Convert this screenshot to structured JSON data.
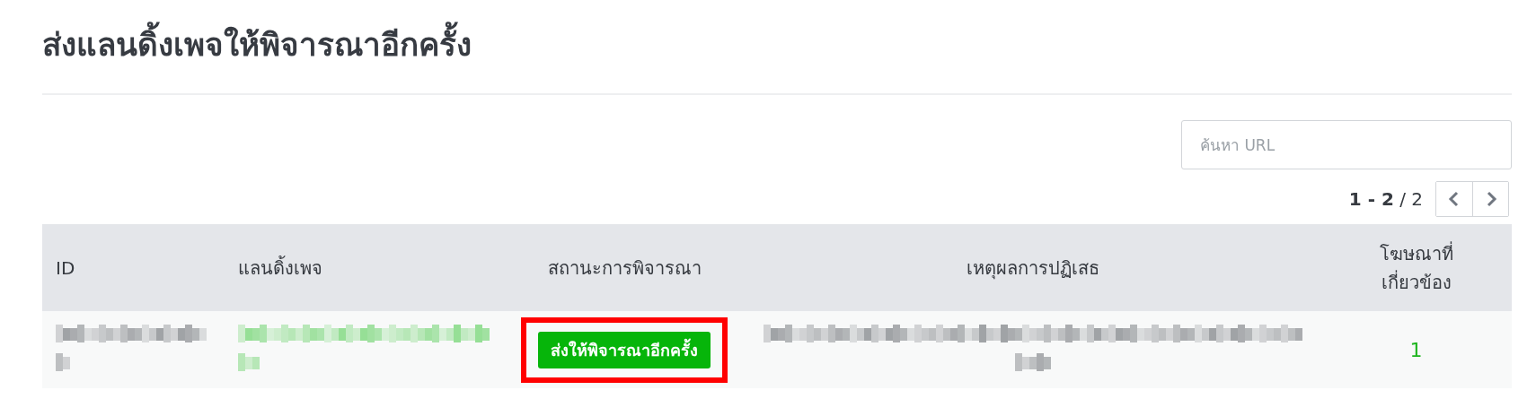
{
  "title": "ส่งแลนดิ้งเพจให้พิจารณาอีกครั้ง",
  "search": {
    "placeholder": "ค้นหา URL"
  },
  "pagination": {
    "range": "1 - 2",
    "total": "/ 2"
  },
  "table": {
    "columns": [
      "ID",
      "แลนดิ้งเพจ",
      "สถานะการพิจารณา",
      "เหตุผลการปฏิเสธ",
      "โฆษณาที่เกี่ยวข้อง"
    ],
    "rows": [
      {
        "cells": [
          {
            "kind": "redacted"
          },
          {
            "kind": "redacted_link"
          },
          {
            "kind": "button",
            "label": "ส่งให้พิจารณาอีกครั้ง",
            "highlighted": true
          },
          {
            "kind": "redacted"
          },
          {
            "kind": "count",
            "text": "1"
          }
        ]
      }
    ]
  }
}
